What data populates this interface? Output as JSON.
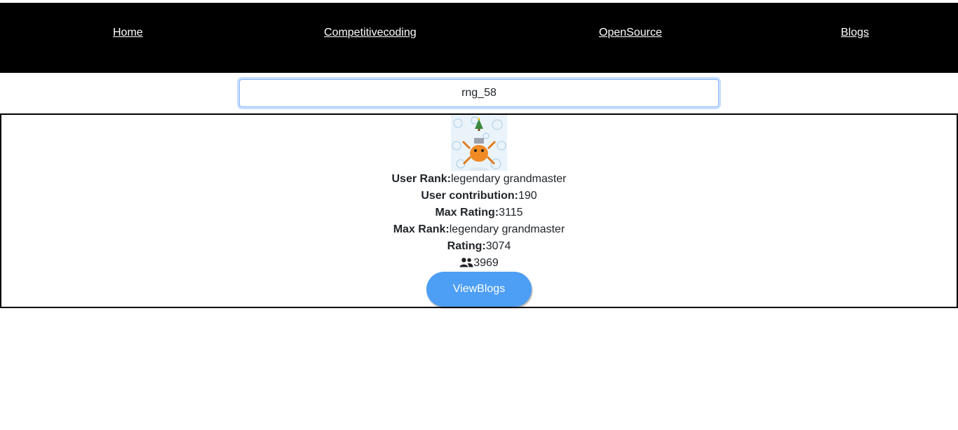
{
  "nav": {
    "home": "Home",
    "competitive": "Competitivecoding",
    "opensource": "OpenSource",
    "blogs": "Blogs"
  },
  "search": {
    "value": "rng_58"
  },
  "profile": {
    "avatar_icon": "avatar-image",
    "rank_label": "User Rank:",
    "rank_value": "legendary grandmaster",
    "contribution_label": "User contribution:",
    "contribution_value": "190",
    "max_rating_label": "Max Rating:",
    "max_rating_value": "3115",
    "max_rank_label": "Max Rank:",
    "max_rank_value": "legendary grandmaster",
    "rating_label": "Rating:",
    "rating_value": "3074",
    "friends_icon": "users-icon",
    "friends_value": "3969",
    "view_blogs_label": "ViewBlogs"
  },
  "colors": {
    "navbar": "#000000",
    "button": "#4d9ef5"
  }
}
